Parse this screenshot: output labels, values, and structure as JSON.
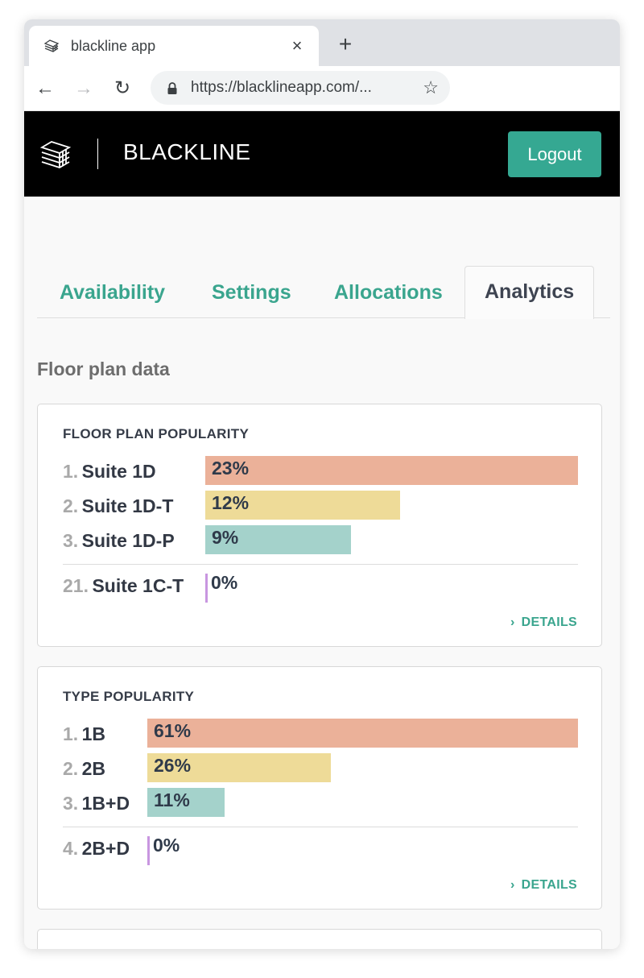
{
  "browser": {
    "tab_title": "blackline app",
    "close_glyph": "×",
    "new_tab_glyph": "+",
    "back_glyph": "←",
    "forward_glyph": "→",
    "reload_glyph": "↻",
    "url": "https://blacklineapp.com/...",
    "star_glyph": "☆"
  },
  "header": {
    "brand": "BLACKLINE",
    "logout_label": "Logout"
  },
  "tabs": [
    {
      "label": "Availability",
      "active": false
    },
    {
      "label": "Settings",
      "active": false
    },
    {
      "label": "Allocations",
      "active": false
    },
    {
      "label": "Analytics",
      "active": true
    }
  ],
  "section_title": "Floor plan data",
  "colors": {
    "accent": "#35a892",
    "bar_first": "#ebb199",
    "bar_second": "#eedb98",
    "bar_third": "#a4d2cb",
    "zero_marker": "#c896e0"
  },
  "cards": [
    {
      "title": "FLOOR PLAN POPULARITY",
      "details_label": "DETAILS",
      "rows": [
        {
          "rank": "1.",
          "label": "Suite 1D",
          "pct_label": "23%",
          "value": 23
        },
        {
          "rank": "2.",
          "label": "Suite 1D-T",
          "pct_label": "12%",
          "value": 12
        },
        {
          "rank": "3.",
          "label": "Suite 1D-P",
          "pct_label": "9%",
          "value": 9
        }
      ],
      "extra_row": {
        "rank": "21.",
        "label": "Suite 1C-T",
        "pct_label": "0%",
        "value": 0
      }
    },
    {
      "title": "TYPE POPULARITY",
      "details_label": "DETAILS",
      "rows": [
        {
          "rank": "1.",
          "label": "1B",
          "pct_label": "61%",
          "value": 61
        },
        {
          "rank": "2.",
          "label": "2B",
          "pct_label": "26%",
          "value": 26
        },
        {
          "rank": "3.",
          "label": "1B+D",
          "pct_label": "11%",
          "value": 11
        }
      ],
      "extra_row": {
        "rank": "4.",
        "label": "2B+D",
        "pct_label": "0%",
        "value": 0
      }
    }
  ]
}
